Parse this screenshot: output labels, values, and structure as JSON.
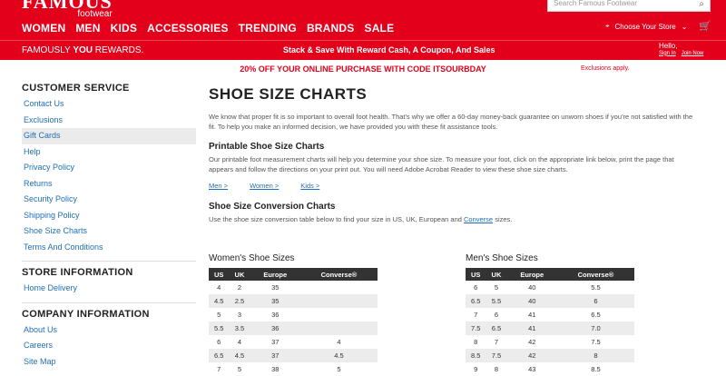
{
  "header": {
    "logo_main": "FAMOUS",
    "logo_sub": "footwear",
    "nav": [
      "WOMEN",
      "MEN",
      "KIDS",
      "ACCESSORIES",
      "TRENDING",
      "BRANDS",
      "SALE"
    ],
    "search_placeholder": "Search Famous Footwear",
    "store_label": "Choose Your Store"
  },
  "rewards": {
    "brand_prefix": "FAMOUSLY ",
    "brand_you": "YOU",
    "brand_suffix": " REWARDS.",
    "message": "Stack & Save With Reward Cash, A Coupon, And Sales",
    "hello": "Hello,",
    "sign_in": "Sign In",
    "join": "Join Now"
  },
  "promo": {
    "text": "20% OFF YOUR ONLINE PURCHASE WITH CODE ITSOURBDAY",
    "exclusions": "Exclusions apply."
  },
  "sidebar": {
    "customer_service_title": "CUSTOMER SERVICE",
    "customer_service": [
      "Contact Us",
      "Exclusions",
      "Gift Cards",
      "Help",
      "Privacy Policy",
      "Returns",
      "Security Policy",
      "Shipping Policy",
      "Shoe Size Charts",
      "Terms And Conditions"
    ],
    "store_info_title": "STORE INFORMATION",
    "store_info": [
      "Home Delivery"
    ],
    "company_info_title": "COMPANY INFORMATION",
    "company_info": [
      "About Us",
      "Careers",
      "Site Map"
    ]
  },
  "main": {
    "title": "SHOE SIZE CHARTS",
    "intro": "We know that proper fit is so important to overall foot health. That's why we offer a 60-day money-back guarantee on unworn shoes if you're not satisfied with the fit. To help you make an informed decision, we have provided you with these fit assistance tools.",
    "printable_title": "Printable Shoe Size Charts",
    "printable_text": "Our printable foot measurement charts will help you determine your shoe size. To measure your foot, click on the appropriate link below, print the page that appears and follow the directions on your print out. You will need Adobe Acrobat Reader to view these shoe size charts.",
    "links": [
      "Men >",
      "Women >",
      "Kids >"
    ],
    "conversion_title": "Shoe Size Conversion Charts",
    "conversion_text_before": "Use the shoe size conversion table below to find your size in US, UK, European and ",
    "conversion_link": "Converse",
    "conversion_text_after": " sizes."
  },
  "womens": {
    "title": "Women's Shoe Sizes",
    "headers": [
      "US",
      "UK",
      "Europe",
      "Converse®"
    ],
    "rows": [
      [
        "4",
        "2",
        "35",
        ""
      ],
      [
        "4.5",
        "2.5",
        "35",
        ""
      ],
      [
        "5",
        "3",
        "36",
        ""
      ],
      [
        "5.5",
        "3.5",
        "36",
        ""
      ],
      [
        "6",
        "4",
        "37",
        "4"
      ],
      [
        "6.5",
        "4.5",
        "37",
        "4.5"
      ],
      [
        "7",
        "5",
        "38",
        "5"
      ]
    ]
  },
  "mens": {
    "title": "Men's Shoe Sizes",
    "headers": [
      "US",
      "UK",
      "Europe",
      "Converse®"
    ],
    "rows": [
      [
        "6",
        "5",
        "40",
        "5.5"
      ],
      [
        "6.5",
        "5.5",
        "40",
        "6"
      ],
      [
        "7",
        "6",
        "41",
        "6.5"
      ],
      [
        "7.5",
        "6.5",
        "41",
        "7.0"
      ],
      [
        "8",
        "7",
        "42",
        "7.5"
      ],
      [
        "8.5",
        "7.5",
        "42",
        "8"
      ],
      [
        "9",
        "8",
        "43",
        "8.5"
      ]
    ]
  }
}
